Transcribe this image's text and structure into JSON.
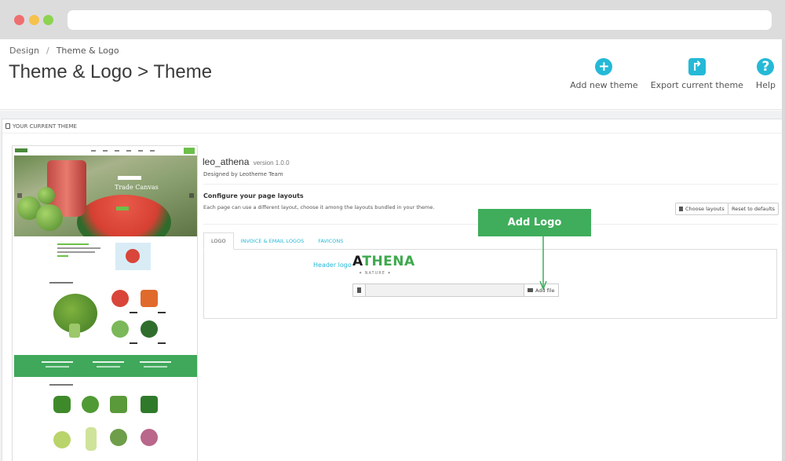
{
  "breadcrumb": {
    "parent": "Design",
    "separator": "/",
    "current": "Theme & Logo"
  },
  "page_title": "Theme & Logo > Theme",
  "toolbar": {
    "add_theme_label": "Add new theme",
    "add_theme_icon": "plus-circle-icon",
    "export_label": "Export current theme",
    "export_icon": "share-icon",
    "help_label": "Help",
    "help_icon": "question-circle-icon",
    "accent": "#25b9d7"
  },
  "panel": {
    "heading": "YOUR CURRENT THEME"
  },
  "preview": {
    "hero_title": "Trade Canvas"
  },
  "theme": {
    "name": "leo_athena",
    "version": "version 1.0.0",
    "author": "Designed by Leotheme Team"
  },
  "layouts": {
    "title": "Configure your page layouts",
    "description": "Each page can use a different layout, choose it among the layouts bundled in your theme.",
    "choose_button": "Choose layouts",
    "reset_button": "Reset to defaults"
  },
  "tabs": [
    {
      "label": "LOGO",
      "active": true
    },
    {
      "label": "INVOICE & EMAIL LOGOS",
      "active": false
    },
    {
      "label": "FAVICONS",
      "active": false
    }
  ],
  "logo_tab": {
    "header_logo_label": "Header logo",
    "logo_text_first": "A",
    "logo_text_rest": "THENA",
    "logo_subtext": "✦ NATURE ✦",
    "add_file_button": "Add file"
  },
  "callout": {
    "label": "Add Logo",
    "color": "#3fad5b"
  }
}
